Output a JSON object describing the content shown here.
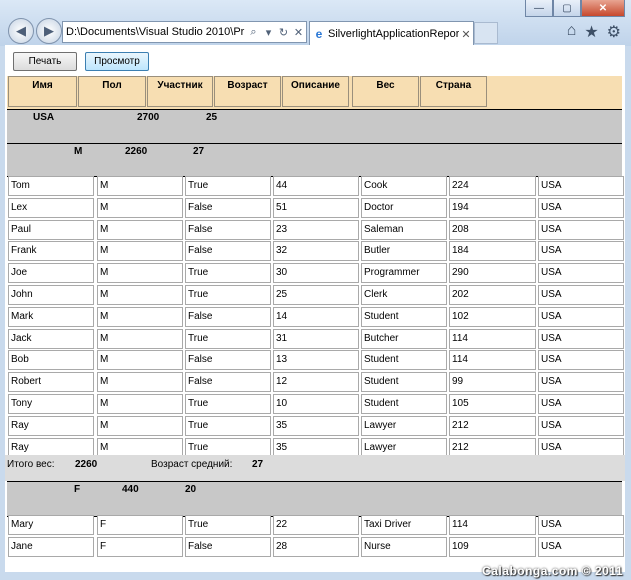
{
  "browser": {
    "address": "D:\\Documents\\Visual Studio 2010\\Pr",
    "tab_title": "SilverlightApplicationRepor..."
  },
  "toolbar": {
    "print_label": "Печать",
    "preview_label": "Просмотр"
  },
  "columns": [
    "Имя",
    "Пол",
    "Участник",
    "Возраст",
    "Описание",
    "Вес",
    "Страна"
  ],
  "group_country": {
    "name": "USA",
    "weight": "2700",
    "count": "25"
  },
  "group_m": {
    "sex": "M",
    "weight": "2260",
    "count": "27"
  },
  "rows_m": [
    [
      "Tom",
      "M",
      "True",
      "44",
      "Cook",
      "224",
      "USA"
    ],
    [
      "Lex",
      "M",
      "False",
      "51",
      "Doctor",
      "194",
      "USA"
    ],
    [
      "Paul",
      "M",
      "False",
      "23",
      "Saleman",
      "208",
      "USA"
    ],
    [
      "Frank",
      "M",
      "False",
      "32",
      "Butler",
      "184",
      "USA"
    ],
    [
      "Joe",
      "M",
      "True",
      "30",
      "Programmer",
      "290",
      "USA"
    ],
    [
      "John",
      "M",
      "True",
      "25",
      "Clerk",
      "202",
      "USA"
    ],
    [
      "Mark",
      "M",
      "False",
      "14",
      "Student",
      "102",
      "USA"
    ],
    [
      "Jack",
      "M",
      "True",
      "31",
      "Butcher",
      "114",
      "USA"
    ],
    [
      "Bob",
      "M",
      "False",
      "13",
      "Student",
      "114",
      "USA"
    ],
    [
      "Robert",
      "M",
      "False",
      "12",
      "Student",
      "99",
      "USA"
    ],
    [
      "Tony",
      "M",
      "True",
      "10",
      "Student",
      "105",
      "USA"
    ],
    [
      "Ray",
      "M",
      "True",
      "35",
      "Lawyer",
      "212",
      "USA"
    ],
    [
      "Ray",
      "M",
      "True",
      "35",
      "Lawyer",
      "212",
      "USA"
    ]
  ],
  "summary": {
    "total_label": "Итого вес:",
    "total_value": "2260",
    "avg_label": "Возраст средний:",
    "avg_value": "27"
  },
  "group_f": {
    "sex": "F",
    "weight": "440",
    "count": "20"
  },
  "rows_f": [
    [
      "Mary",
      "F",
      "True",
      "22",
      "Taxi Driver",
      "114",
      "USA"
    ],
    [
      "Jane",
      "F",
      "False",
      "28",
      "Nurse",
      "109",
      "USA"
    ]
  ],
  "watermark": "Calabonga.com © 2011"
}
